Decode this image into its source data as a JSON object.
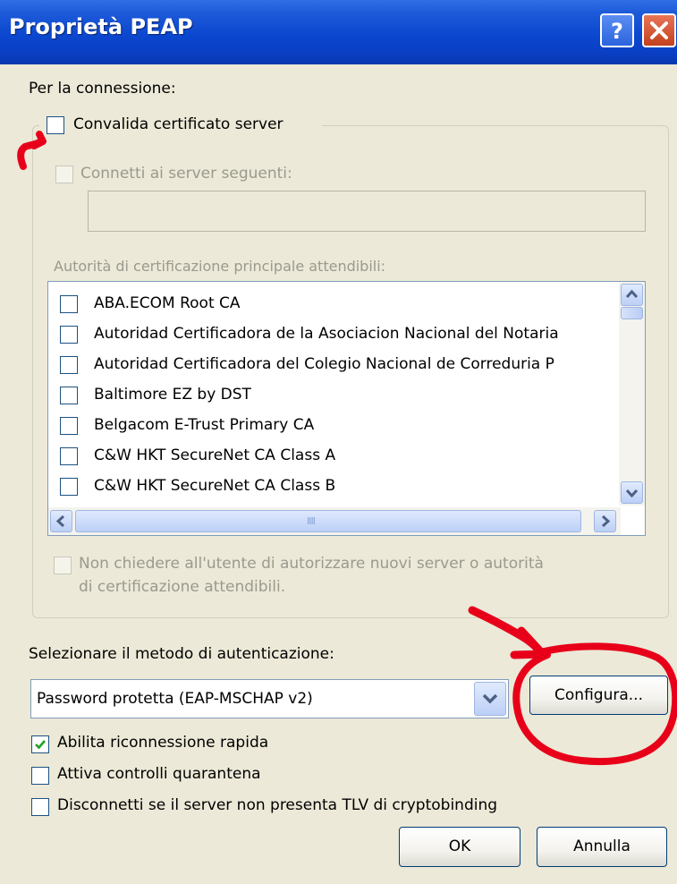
{
  "window": {
    "title": "Proprietà PEAP",
    "help_icon": "?",
    "close_icon": "X"
  },
  "connection": {
    "heading": "Per la connessione:",
    "validate_certificate_label": "Convalida certificato server",
    "validate_certificate_checked": false,
    "connect_servers_label": "Connetti ai server seguenti:",
    "connect_servers_checked": false,
    "servers_value": "",
    "trusted_cas_label": "Autorità di certificazione principale attendibili:",
    "trusted_cas": [
      {
        "name": "ABA.ECOM Root CA",
        "checked": false
      },
      {
        "name": "Autoridad Certificadora de la Asociacion Nacional del Notaria",
        "checked": false
      },
      {
        "name": "Autoridad Certificadora del Colegio Nacional de Correduria P",
        "checked": false
      },
      {
        "name": "Baltimore EZ by DST",
        "checked": false
      },
      {
        "name": "Belgacom E-Trust Primary CA",
        "checked": false
      },
      {
        "name": "C&W HKT SecureNet CA Class A",
        "checked": false
      },
      {
        "name": "C&W HKT SecureNet CA Class B",
        "checked": false
      }
    ],
    "hscroll_grip": "IIII",
    "no_prompt_line1": "Non chiedere all'utente di autorizzare nuovi server o autorità",
    "no_prompt_line2": "di certificazione attendibili.",
    "no_prompt_checked": false
  },
  "auth": {
    "method_label": "Selezionare il metodo di autenticazione:",
    "method_value": "Password protetta (EAP-MSCHAP v2)",
    "configure_label": "Configura...",
    "fast_reconnect_label": "Abilita riconnessione rapida",
    "fast_reconnect_checked": true,
    "quarantine_label": "Attiva controlli quarantena",
    "quarantine_checked": false,
    "cryptobinding_label": "Disconnetti se il server non presenta TLV di cryptobinding",
    "cryptobinding_checked": false
  },
  "buttons": {
    "ok_label": "OK",
    "cancel_label": "Annulla"
  },
  "colors": {
    "annotation": "#e8001a",
    "titlebar": "#0b47cf",
    "dialog_bg": "#ece9d8",
    "checkmark": "#21a121"
  }
}
